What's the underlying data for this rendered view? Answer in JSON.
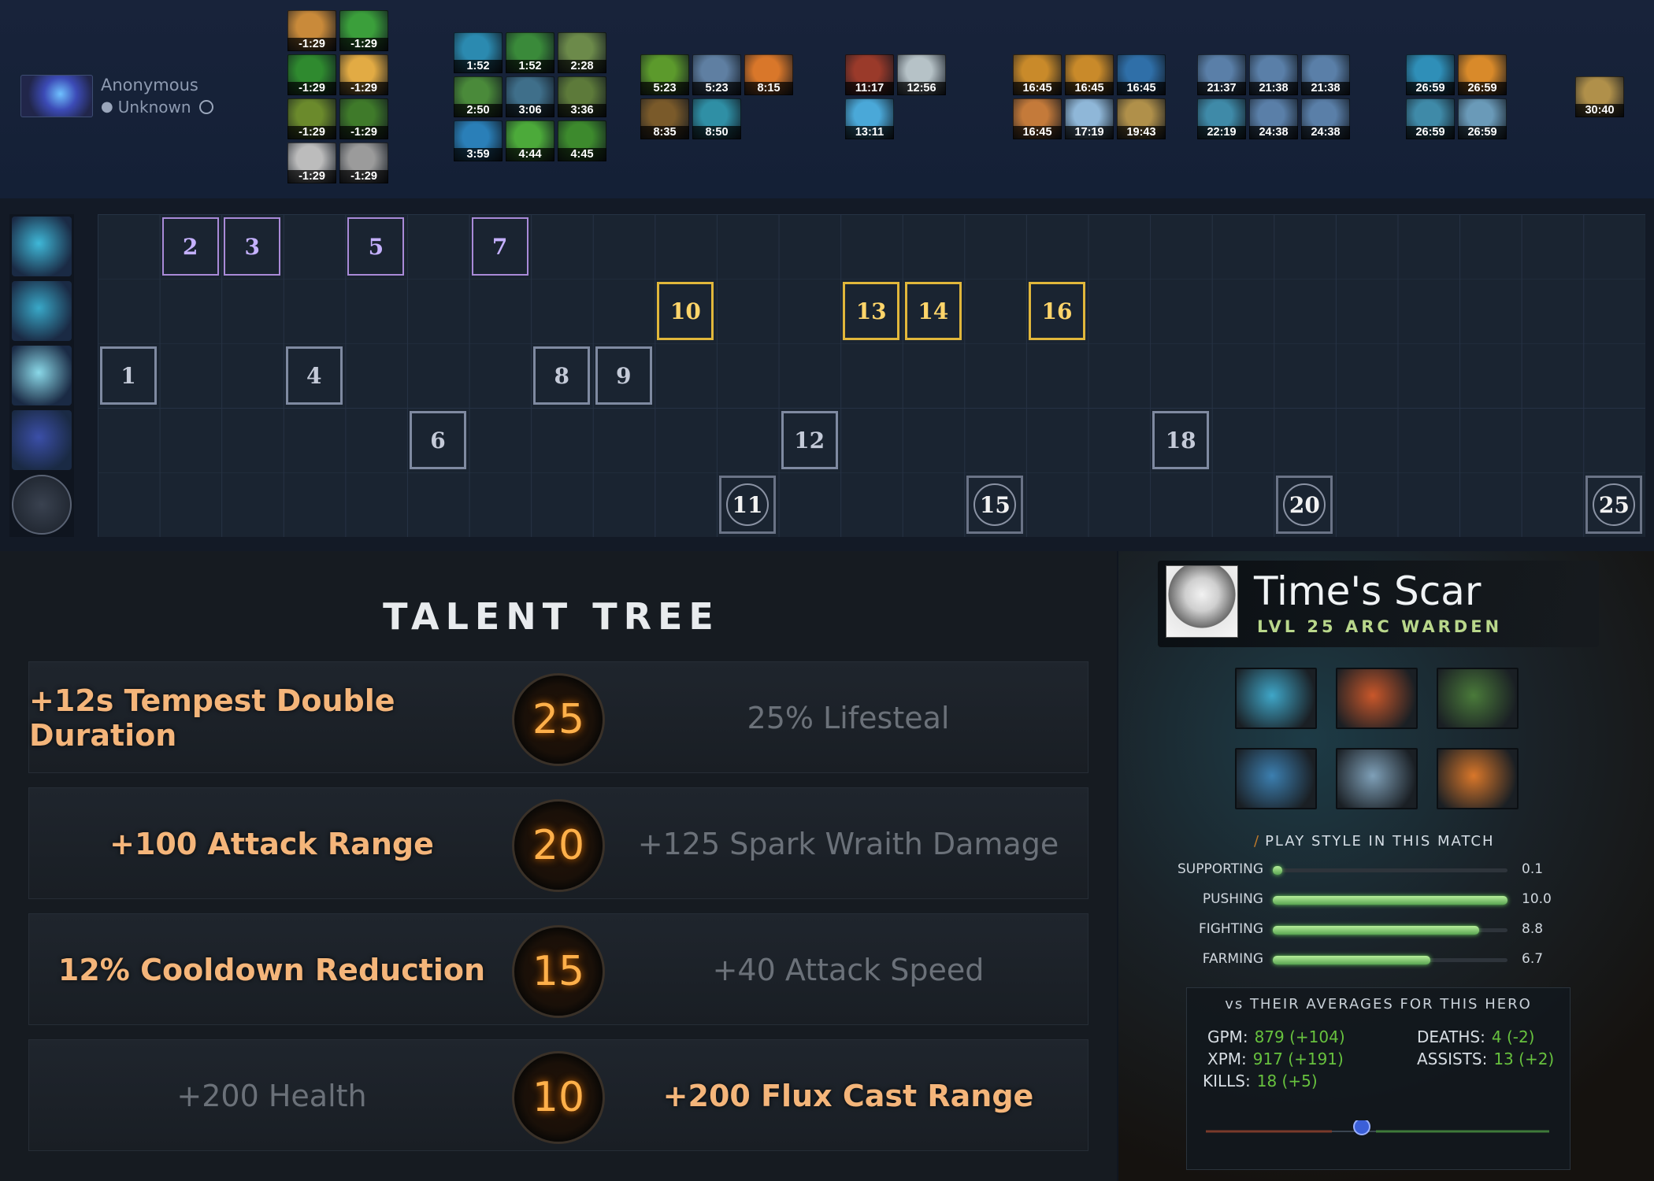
{
  "player": {
    "name": "Anonymous",
    "status": "Unknown"
  },
  "timeline_items": [
    {
      "time": "-1:29",
      "color": "#c98a3a"
    },
    {
      "time": "-1:29",
      "color": "#3b9f3b"
    },
    {
      "time": "-1:29",
      "color": "#2f8a2f"
    },
    {
      "time": "-1:29",
      "color": "#e2ab44"
    },
    {
      "time": "-1:29",
      "color": "#6b8a2c"
    },
    {
      "time": "-1:29",
      "color": "#3f7a2a"
    },
    {
      "time": "-1:29",
      "color": "#bcbcbc"
    },
    {
      "time": "-1:29",
      "color": "#9b9b9b"
    },
    {
      "time": "1:52",
      "color": "#2b8ab0"
    },
    {
      "time": "1:52",
      "color": "#3a8a3a"
    },
    {
      "time": "2:28",
      "color": "#6c8a4a"
    },
    {
      "time": "2:50",
      "color": "#4a8a3a"
    },
    {
      "time": "3:06",
      "color": "#3f6f8a"
    },
    {
      "time": "3:36",
      "color": "#5d7a3a"
    },
    {
      "time": "3:59",
      "color": "#2a7fb8"
    },
    {
      "time": "4:44",
      "color": "#4caa3a"
    },
    {
      "time": "4:45",
      "color": "#3d8a2d"
    },
    {
      "time": "5:23",
      "color": "#5c9a2c"
    },
    {
      "time": "5:23",
      "color": "#5f7fa2"
    },
    {
      "time": "8:15",
      "color": "#d9772a"
    },
    {
      "time": "8:35",
      "color": "#7a5a2a"
    },
    {
      "time": "8:50",
      "color": "#2f8fa5"
    },
    {
      "time": "11:17",
      "color": "#9a3a2a"
    },
    {
      "time": "12:56",
      "color": "#b6c2c7"
    },
    {
      "time": "13:11",
      "color": "#4aa8d8"
    },
    {
      "time": "16:45",
      "color": "#c98a2a"
    },
    {
      "time": "16:45",
      "color": "#c98a2a"
    },
    {
      "time": "16:45",
      "color": "#2f6fa8"
    },
    {
      "time": "16:45",
      "color": "#c47a3a"
    },
    {
      "time": "17:19",
      "color": "#8fb7d8"
    },
    {
      "time": "19:43",
      "color": "#b0904a"
    },
    {
      "time": "21:37",
      "color": "#5a7fa8"
    },
    {
      "time": "21:38",
      "color": "#5a7fa8"
    },
    {
      "time": "21:38",
      "color": "#5a7fa8"
    },
    {
      "time": "22:19",
      "color": "#3f8aa8"
    },
    {
      "time": "24:38",
      "color": "#5a7fa8"
    },
    {
      "time": "24:38",
      "color": "#5a7fa8"
    },
    {
      "time": "26:59",
      "color": "#2f8fb8"
    },
    {
      "time": "26:59",
      "color": "#d98a2a"
    },
    {
      "time": "26:59",
      "color": "#3f8aa8"
    },
    {
      "time": "26:59",
      "color": "#6a9ab8"
    },
    {
      "time": "30:40",
      "color": "#b0904a"
    }
  ],
  "skill_build": [
    {
      "level": "1",
      "row": 2
    },
    {
      "level": "2",
      "row": 0
    },
    {
      "level": "3",
      "row": 0
    },
    {
      "level": "4",
      "row": 2
    },
    {
      "level": "5",
      "row": 0
    },
    {
      "level": "6",
      "row": 3
    },
    {
      "level": "7",
      "row": 0
    },
    {
      "level": "8",
      "row": 2
    },
    {
      "level": "9",
      "row": 2
    },
    {
      "level": "10",
      "row": 1
    },
    {
      "level": "11",
      "row": 4
    },
    {
      "level": "12",
      "row": 3
    },
    {
      "level": "13",
      "row": 1
    },
    {
      "level": "14",
      "row": 1
    },
    {
      "level": "15",
      "row": 4
    },
    {
      "level": "16",
      "row": 1
    },
    {
      "level": "18",
      "row": 3
    },
    {
      "level": "20",
      "row": 4
    },
    {
      "level": "25",
      "row": 4
    }
  ],
  "skill_icons": [
    {
      "name": "flux-icon",
      "color": "#3fb8d8"
    },
    {
      "name": "magnetic-field-icon",
      "color": "#39a8c8"
    },
    {
      "name": "spark-wraith-icon",
      "color": "#8ad8e8"
    },
    {
      "name": "tempest-double-icon",
      "color": "#3b4fa8"
    },
    {
      "name": "talent-icon",
      "color": "#56606e"
    }
  ],
  "talent_tree": {
    "title": "TALENT TREE",
    "rows": [
      {
        "level": "25",
        "left": "+12s Tempest Double Duration",
        "right": "25% Lifesteal",
        "picked": "left"
      },
      {
        "level": "20",
        "left": "+100 Attack Range",
        "right": "+125 Spark Wraith Damage",
        "picked": "left"
      },
      {
        "level": "15",
        "left": "12% Cooldown Reduction",
        "right": "+40 Attack Speed",
        "picked": "left"
      },
      {
        "level": "10",
        "left": "+200 Health",
        "right": "+200 Flux Cast Range",
        "picked": "right"
      }
    ]
  },
  "match_card": {
    "player_name": "Time's Scar",
    "hero_line": "LVL 25 ARC WARDEN",
    "items": [
      {
        "name": "item-icon",
        "color": "#3fa6c8"
      },
      {
        "name": "item-icon",
        "color": "#c9572a"
      },
      {
        "name": "item-icon",
        "color": "#4a7a3a"
      },
      {
        "name": "item-icon",
        "color": "#3c7fb0"
      },
      {
        "name": "item-icon",
        "color": "#7fa0b8"
      },
      {
        "name": "item-icon",
        "color": "#d9772a"
      }
    ],
    "playstyle_title": "PLAY STYLE IN THIS MATCH",
    "playstyle": [
      {
        "label": "SUPPORTING",
        "value": "0.1",
        "pct": 0.01
      },
      {
        "label": "PUSHING",
        "value": "10.0",
        "pct": 1.0
      },
      {
        "label": "FIGHTING",
        "value": "8.8",
        "pct": 0.88
      },
      {
        "label": "FARMING",
        "value": "6.7",
        "pct": 0.67
      }
    ],
    "averages_title": "vs THEIR AVERAGES FOR THIS HERO",
    "averages": {
      "gpm_label": "GPM:",
      "gpm": "879 (+104)",
      "xpm_label": "XPM:",
      "xpm": "917 (+191)",
      "kills_label": "KILLS:",
      "kills": "18 (+5)",
      "deaths_label": "DEATHS:",
      "deaths": "4 (-2)",
      "assists_label": "ASSISTS:",
      "assists": "13 (+2)"
    }
  }
}
